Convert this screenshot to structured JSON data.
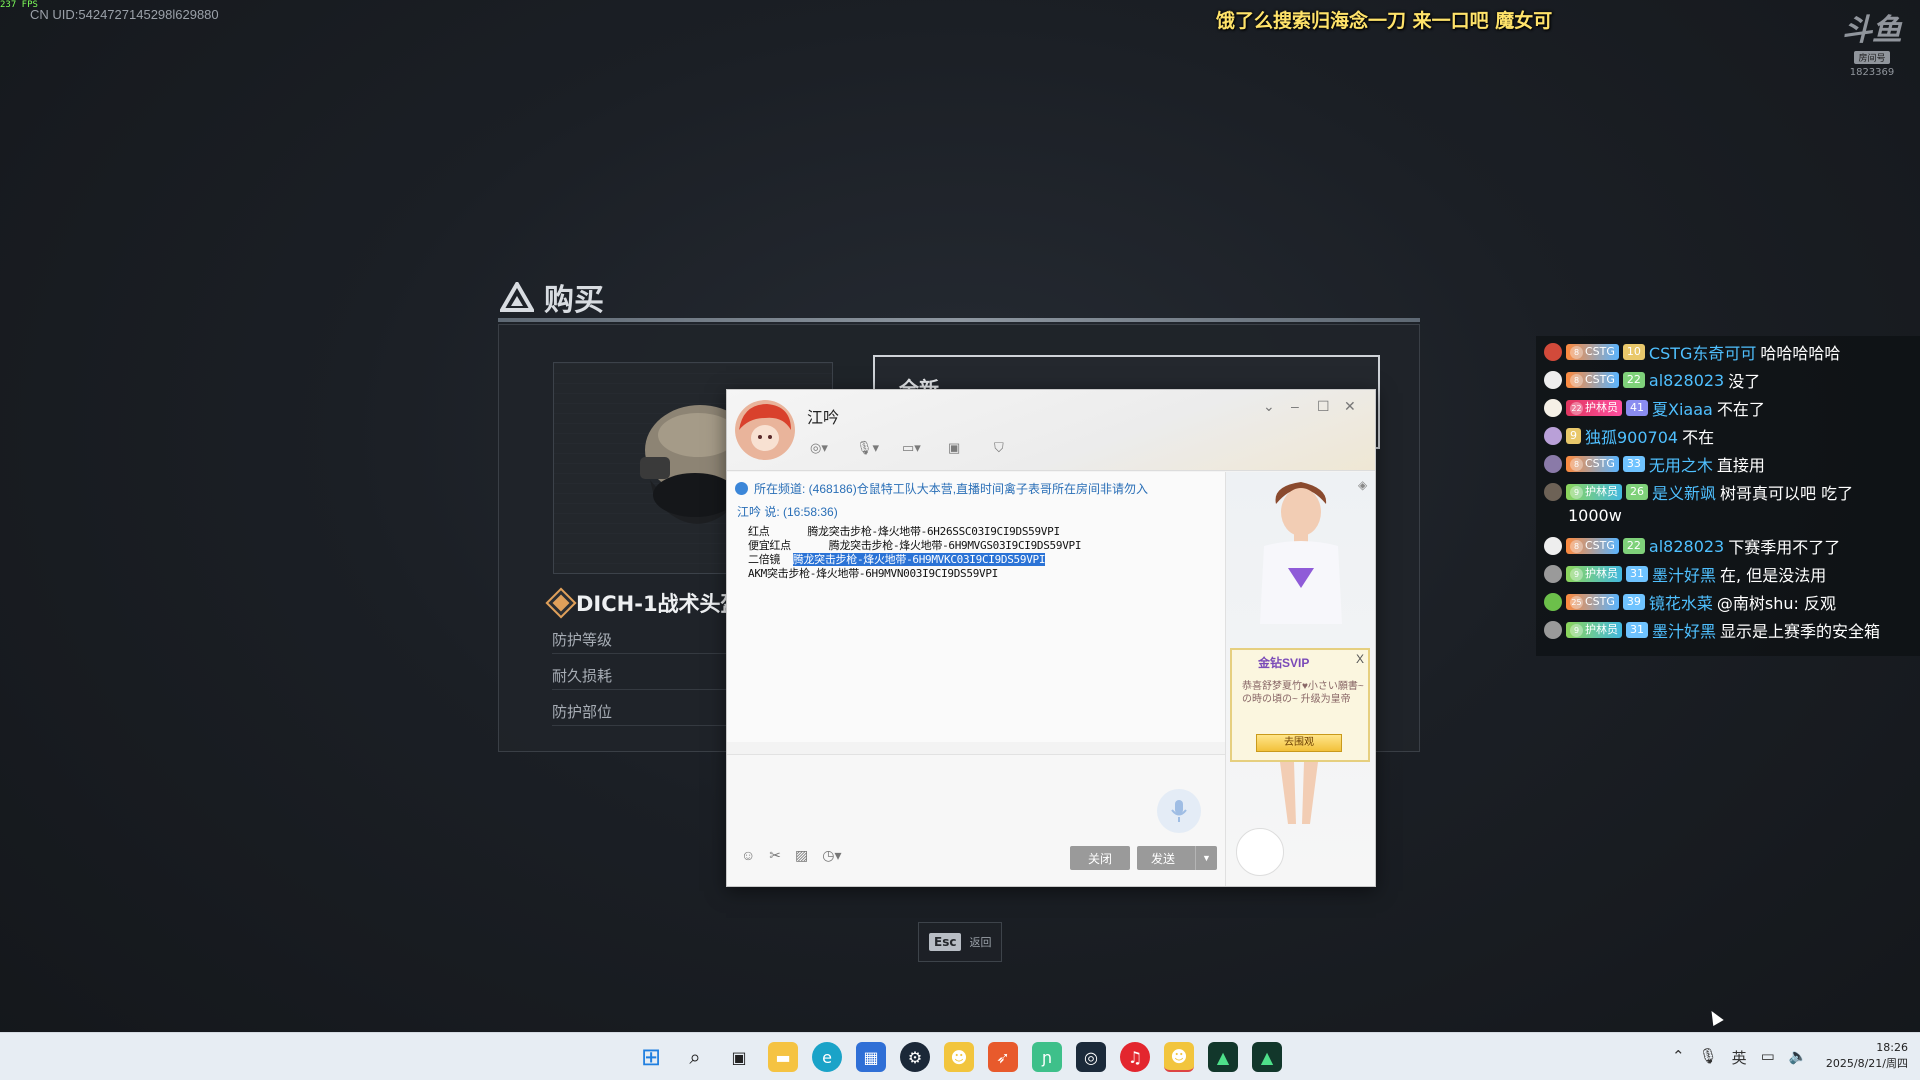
{
  "overlay": {
    "fps": "237 FPS",
    "uid": "CN UID:5424727145298l629880",
    "banner": "饿了么搜索归海念一刀 来一口吧 魔女可",
    "room_logo": {
      "mark": "斗鱼",
      "tag": "房间号",
      "number": "1823369"
    }
  },
  "game": {
    "title": "购买",
    "item_name": "DICH-1战术头盔",
    "stats": [
      "防护等级",
      "耐久损耗",
      "防护部位"
    ],
    "right_tab": "全新",
    "esc_key": "Esc",
    "esc_label": "返回"
  },
  "chat": {
    "contact_name": "江吟",
    "notice": "所在频道: (468186)仓鼠特工队大本营,直播时间禽子表哥所在房间非请勿入",
    "sender_line": "江吟 说: (16:58:36)",
    "messages": [
      {
        "prefix": "红点      ",
        "text": "腾龙突击步枪-烽火地带-6H26SSC03I9CI9DS59VPI",
        "highlight": ""
      },
      {
        "prefix": "便宜红点      ",
        "text": "腾龙突击步枪-烽火地带-6H9MVGS03I9CI9DS59VPI",
        "highlight": ""
      },
      {
        "prefix": "二倍镜  ",
        "text": "",
        "highlight": "腾龙突击步枪-烽火地带-6H9MVKC03I9CI9DS59VPI"
      },
      {
        "prefix": "",
        "text": "AKM突击步枪-烽火地带-6H9MVN003I9CI9DS59VPI",
        "highlight": ""
      }
    ],
    "close_label": "关闭",
    "send_label": "发送",
    "svip": {
      "title": "金钻SVIP",
      "close": "X",
      "text": "恭喜舒梦夏竹♥小さい願書~の時の頃の~ 升级为皇帝",
      "button": "去围观"
    }
  },
  "danmaku": [
    {
      "level": "8",
      "club": "CSTG",
      "fan": "10",
      "user": "CSTG东奇可可",
      "text": "哈哈哈哈哈"
    },
    {
      "level": "8",
      "club": "CSTG",
      "fan": "22",
      "user": "al828023",
      "text": "没了"
    },
    {
      "level": "22",
      "club": "护林员",
      "fan": "41",
      "user": "夏Xiaaa",
      "text": "不在了"
    },
    {
      "level": "",
      "club": "",
      "fan": "9",
      "user": "独孤900704",
      "text": "不在"
    },
    {
      "level": "8",
      "club": "CSTG",
      "fan": "33",
      "user": "无用之木",
      "text": "直接用"
    },
    {
      "level": "9",
      "club": "护林员",
      "fan": "26",
      "user": "是义新飒",
      "text": "树哥真可以吧 吃了"
    },
    {
      "level": "",
      "club": "",
      "fan": "",
      "user": "",
      "text": "1000w"
    },
    {
      "level": "8",
      "club": "CSTG",
      "fan": "22",
      "user": "al828023",
      "text": "下赛季用不了了"
    },
    {
      "level": "9",
      "club": "护林员",
      "fan": "31",
      "user": "墨汁好黑",
      "text": "在, 但是没法用"
    },
    {
      "level": "25",
      "club": "CSTG",
      "fan": "39",
      "user": "镜花水菜",
      "text": "@南树shu: 反观"
    },
    {
      "level": "9",
      "club": "护林员",
      "fan": "31",
      "user": "墨汁好黑",
      "text": "显示是上赛季的安全箱"
    }
  ],
  "taskbar": {
    "tray_lang": "英",
    "time": "18:26",
    "date": "2025/8/21/周四"
  },
  "colors": {
    "accent_blue": "#2b73d6",
    "danmu_user": "#4fc0ff",
    "banner_yellow": "#ffe36a"
  }
}
